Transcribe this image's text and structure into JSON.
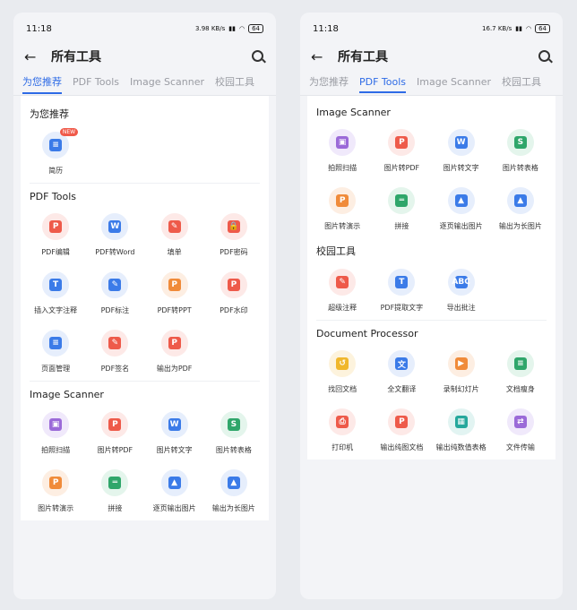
{
  "status": {
    "time": "11:18",
    "battery": "64",
    "net_left": "3.98 KB/s",
    "net_right": "16.7 KB/s"
  },
  "appbar": {
    "title": "所有工具",
    "back_icon": "arrow-left-icon",
    "search_icon": "search-icon"
  },
  "tabs": [
    "为您推荐",
    "PDF Tools",
    "Image Scanner",
    "校园工具"
  ],
  "left": {
    "recommend": {
      "title": "为您推荐",
      "items": [
        {
          "label": "简历",
          "badge": "NEW",
          "color": "blue",
          "glyph": "≡"
        }
      ]
    },
    "pdf": {
      "title": "PDF Tools",
      "items": [
        {
          "label": "PDF编辑",
          "color": "red",
          "glyph": "P"
        },
        {
          "label": "PDF转Word",
          "color": "blue",
          "glyph": "W"
        },
        {
          "label": "填单",
          "color": "red",
          "glyph": "✎"
        },
        {
          "label": "PDF密码",
          "color": "red",
          "glyph": "🔒"
        },
        {
          "label": "插入文字注释",
          "color": "blue",
          "glyph": "T"
        },
        {
          "label": "PDF标注",
          "color": "blue",
          "glyph": "✎"
        },
        {
          "label": "PDF转PPT",
          "color": "orange",
          "glyph": "P"
        },
        {
          "label": "PDF水印",
          "color": "red",
          "glyph": "P"
        },
        {
          "label": "页面管理",
          "color": "blue",
          "glyph": "≡"
        },
        {
          "label": "PDF签名",
          "color": "red",
          "glyph": "✎"
        },
        {
          "label": "输出为PDF",
          "color": "red",
          "glyph": "P"
        }
      ]
    },
    "scanner": {
      "title": "Image Scanner",
      "items": [
        {
          "label": "拍照扫描",
          "color": "purple",
          "glyph": "▣"
        },
        {
          "label": "图片转PDF",
          "color": "red",
          "glyph": "P"
        },
        {
          "label": "图片转文字",
          "color": "blue",
          "glyph": "W"
        },
        {
          "label": "图片转表格",
          "color": "green",
          "glyph": "S"
        },
        {
          "label": "图片转演示",
          "color": "orange",
          "glyph": "P"
        },
        {
          "label": "拼接",
          "color": "green",
          "glyph": "═"
        },
        {
          "label": "逐页输出图片",
          "color": "blue",
          "glyph": "▲"
        },
        {
          "label": "输出为长图片",
          "color": "blue",
          "glyph": "▲"
        }
      ]
    }
  },
  "right": {
    "scanner": {
      "title": "Image Scanner",
      "items": [
        {
          "label": "拍照扫描",
          "color": "purple",
          "glyph": "▣"
        },
        {
          "label": "图片转PDF",
          "color": "red",
          "glyph": "P"
        },
        {
          "label": "图片转文字",
          "color": "blue",
          "glyph": "W"
        },
        {
          "label": "图片转表格",
          "color": "green",
          "glyph": "S"
        },
        {
          "label": "图片转演示",
          "color": "orange",
          "glyph": "P"
        },
        {
          "label": "拼接",
          "color": "green",
          "glyph": "═"
        },
        {
          "label": "逐页输出图片",
          "color": "blue",
          "glyph": "▲"
        },
        {
          "label": "输出为长图片",
          "color": "blue",
          "glyph": "▲"
        }
      ]
    },
    "campus": {
      "title": "校园工具",
      "items": [
        {
          "label": "超级注释",
          "color": "red",
          "glyph": "✎"
        },
        {
          "label": "PDF提取文字",
          "color": "blue",
          "glyph": "T"
        },
        {
          "label": "导出批注",
          "color": "blue",
          "glyph": "ABC"
        }
      ]
    },
    "docs": {
      "title": "Document Processor",
      "items": [
        {
          "label": "找回文档",
          "color": "yellow",
          "glyph": "↺"
        },
        {
          "label": "全文翻译",
          "color": "blue",
          "glyph": "文"
        },
        {
          "label": "录制幻灯片",
          "color": "orange",
          "glyph": "▶"
        },
        {
          "label": "文档瘦身",
          "color": "green",
          "glyph": "≡"
        },
        {
          "label": "打印机",
          "color": "red",
          "glyph": "⎙"
        },
        {
          "label": "输出纯图文档",
          "color": "red",
          "glyph": "P"
        },
        {
          "label": "输出纯数值表格",
          "color": "teal",
          "glyph": "▦"
        },
        {
          "label": "文件传输",
          "color": "purple",
          "glyph": "⇄"
        }
      ]
    }
  }
}
